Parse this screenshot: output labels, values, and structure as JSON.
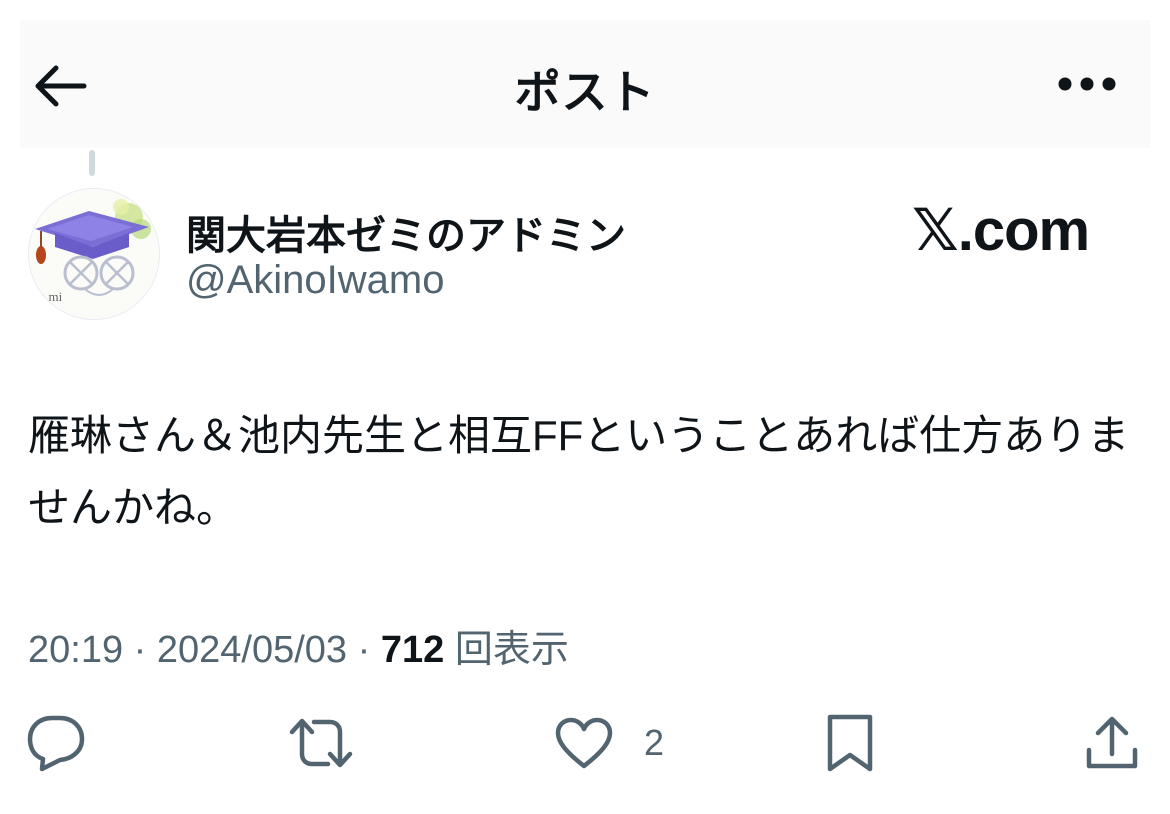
{
  "header": {
    "title": "ポスト"
  },
  "icons": {
    "back": "arrow-left-icon",
    "more": "more-dots-icon",
    "reply": "reply-bubble-icon",
    "repost": "repost-icon",
    "like": "heart-icon",
    "bookmark": "bookmark-icon",
    "share": "share-icon"
  },
  "author": {
    "display_name": "関大岩本ゼミのアドミン",
    "handle": "@AkinoIwamo",
    "avatar_label": "va mi"
  },
  "source": "𝕏.com",
  "tweet": {
    "text": "雁琳さん＆池内先生と相互FFということあれば仕方ありませんかね。"
  },
  "meta": {
    "time": "20:19",
    "separator": " · ",
    "date": "2024/05/03",
    "views_count": "712",
    "views_label": "回表示"
  },
  "actions": {
    "likes_count": "2"
  },
  "colors": {
    "text": "#0f1419",
    "secondary": "#536471",
    "header_bg": "#fafafa"
  }
}
